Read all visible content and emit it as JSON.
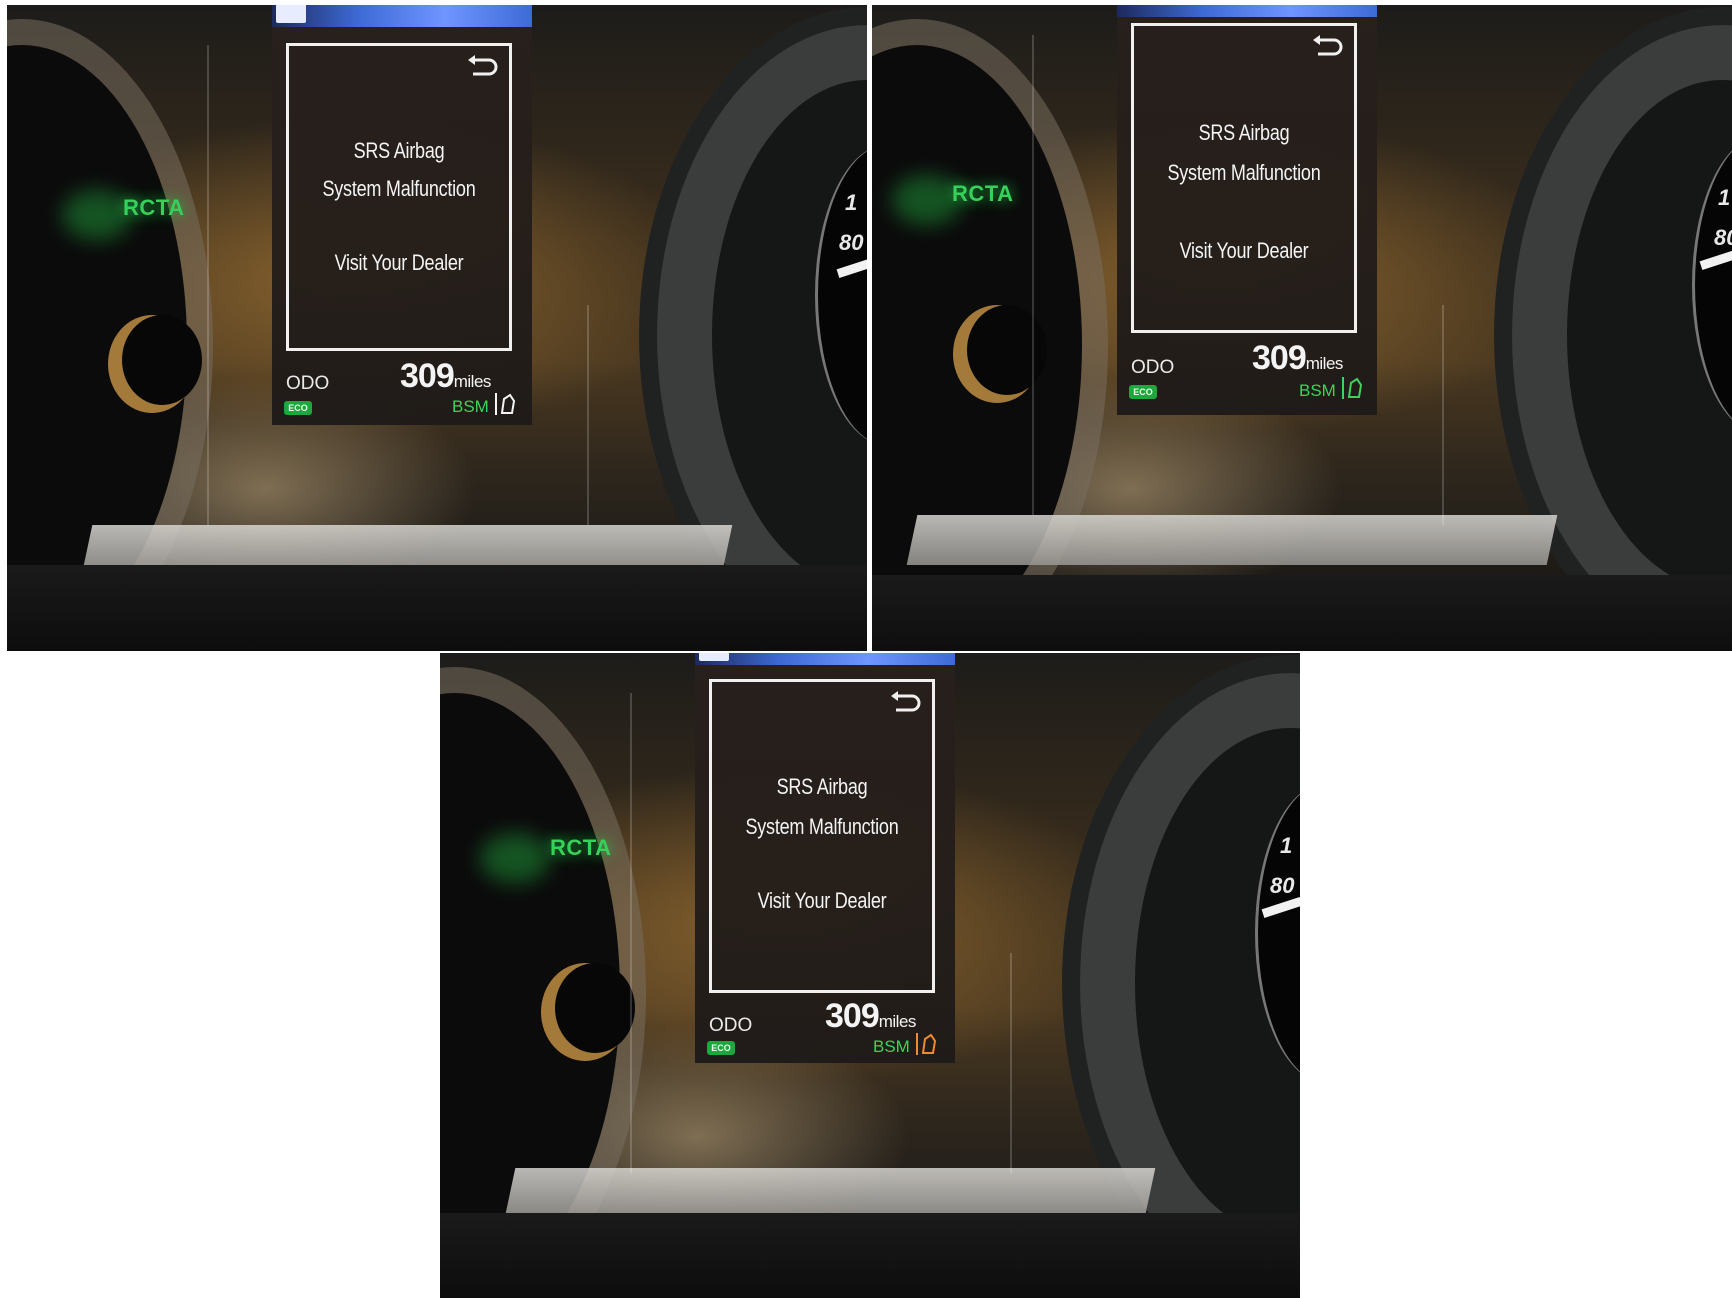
{
  "cluster": {
    "indicator_left": "RCTA",
    "message_line1": "SRS Airbag",
    "message_line2": "System Malfunction",
    "message_line3": "Visit Your Dealer",
    "odo_label": "ODO",
    "odo_value": "309",
    "odo_unit": "miles",
    "eco_badge": "ECO",
    "bsm_label": "BSM",
    "speed_label_top": "1",
    "speed_label_80": "80",
    "back_icon": "return-arrow-icon"
  },
  "photos": [
    {
      "bsm_icon_color": "#f5f5f5"
    },
    {
      "bsm_icon_color": "#3cd45c"
    },
    {
      "bsm_icon_color": "#f08a2a"
    }
  ],
  "colors": {
    "indicator_green": "#36d05a",
    "eco_green": "#1fa73f",
    "display_text": "#f4f4f4"
  }
}
